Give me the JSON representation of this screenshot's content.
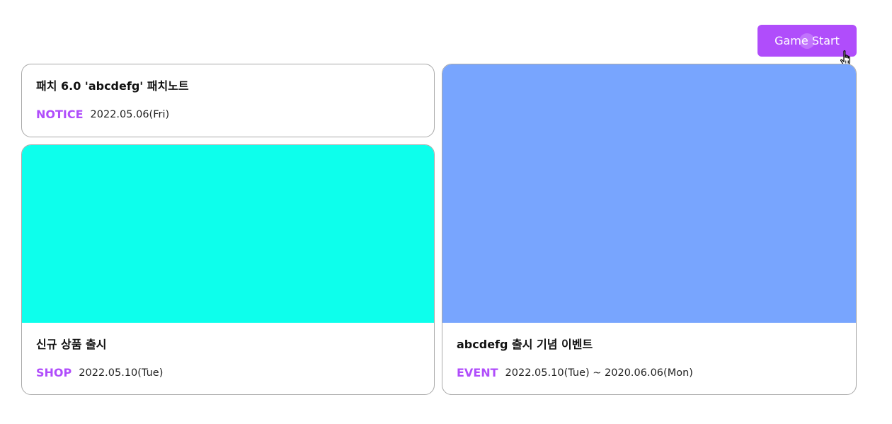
{
  "header": {
    "start_button_label": "Game Start"
  },
  "colors": {
    "accent": "#b04dfb",
    "card_border": "#a9a9a9",
    "shop_thumb": "#0dffec",
    "event_thumb": "#78a5fe"
  },
  "icons": {
    "cursor": "pointer-hand-icon"
  },
  "cards": {
    "notice": {
      "title": "패치 6.0 'abcdefg' 패치노트",
      "category": "NOTICE",
      "date": "2022.05.06(Fri)"
    },
    "shop": {
      "title": "신규 상품 출시",
      "category": "SHOP",
      "date": "2022.05.10(Tue)"
    },
    "event": {
      "title": "abcdefg 출시 기념 이벤트",
      "category": "EVENT",
      "date": "2022.05.10(Tue) ~ 2020.06.06(Mon)"
    }
  }
}
